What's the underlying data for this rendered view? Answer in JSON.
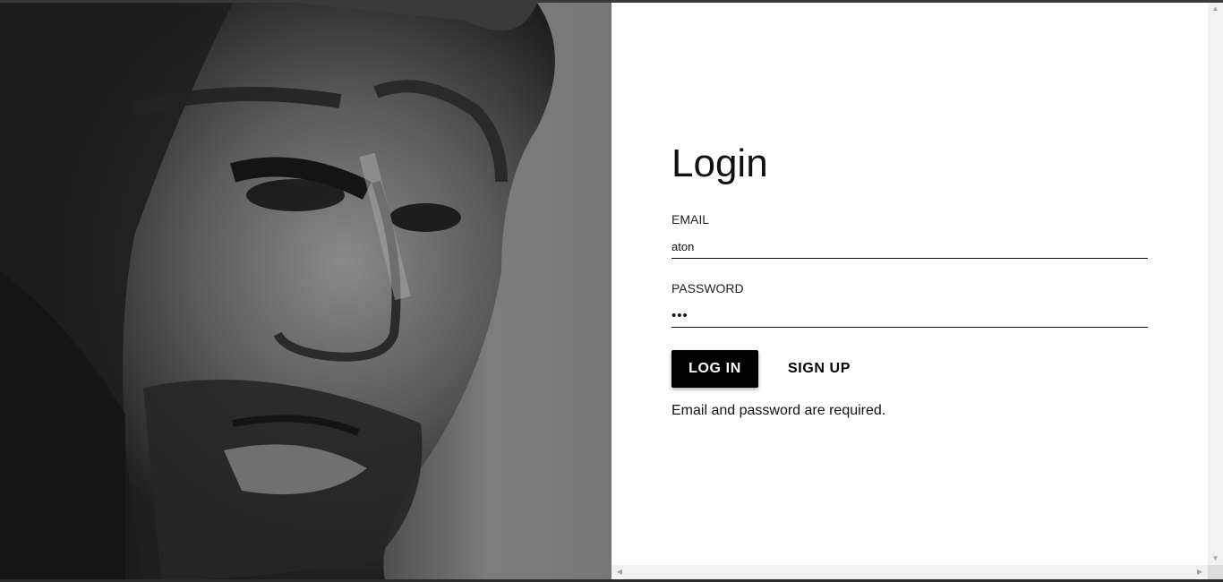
{
  "login": {
    "title": "Login",
    "email_label": "EMAIL",
    "email_value": "aton",
    "password_label": "PASSWORD",
    "password_value": "abc",
    "login_button": "LOG IN",
    "signup_button": "SIGN UP",
    "error_message": "Email and password are required."
  },
  "scrollbars": {
    "up_arrow": "▲",
    "down_arrow": "▼",
    "left_arrow": "◀",
    "right_arrow": "▶"
  }
}
